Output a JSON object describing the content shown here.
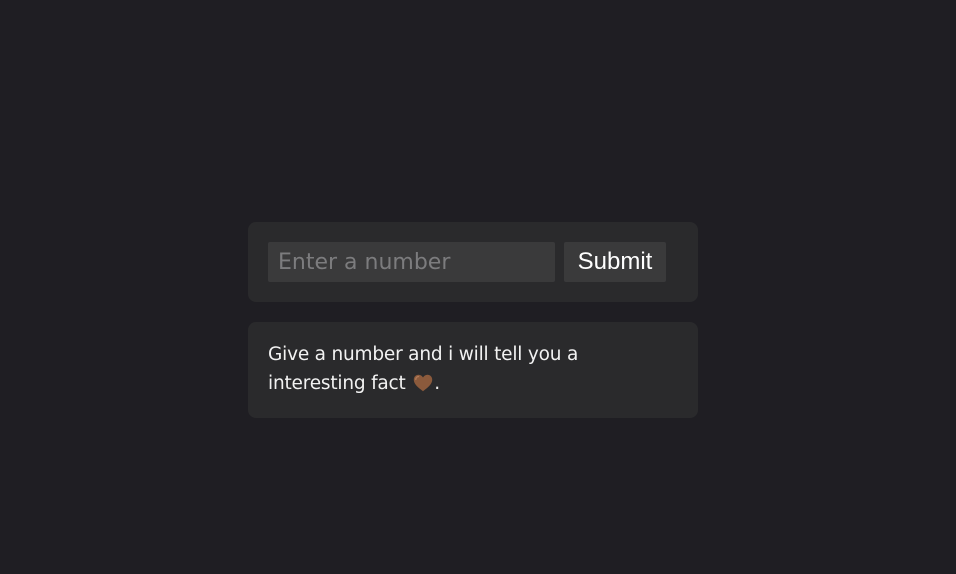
{
  "form": {
    "input_value": "",
    "input_placeholder": "Enter a number",
    "submit_label": "Submit"
  },
  "fact": {
    "text_before_icon": "Give a number and i will tell you a interesting fact ",
    "icon": "brown-heart-icon",
    "text_after_icon": "."
  },
  "colors": {
    "background": "#1f1e23",
    "card": "#2a2a2c",
    "field": "#3a3a3b",
    "heart": "#8b5a3c"
  }
}
